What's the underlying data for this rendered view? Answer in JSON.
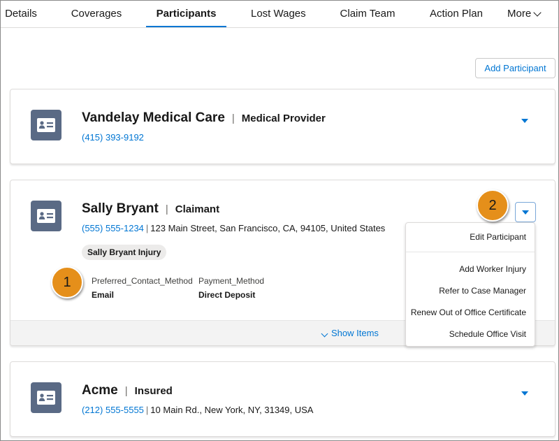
{
  "tabs": [
    {
      "label": "Details"
    },
    {
      "label": "Coverages"
    },
    {
      "label": "Participants",
      "active": true
    },
    {
      "label": "Lost Wages"
    },
    {
      "label": "Claim Team"
    },
    {
      "label": "Action Plan"
    },
    {
      "label": "More"
    }
  ],
  "add_participant_label": "Add Participant",
  "participants": [
    {
      "name": "Vandelay Medical Care",
      "role": "Medical Provider",
      "phone": "(415) 393-9192"
    },
    {
      "name": "Sally Bryant",
      "role": "Claimant",
      "phone": "(555) 555-1234",
      "address": "123 Main Street, San Francisco, CA, 94105, United States",
      "pill": "Sally Bryant Injury",
      "fields": [
        {
          "label": "Preferred_Contact_Method",
          "value": "Email"
        },
        {
          "label": "Payment_Method",
          "value": "Direct Deposit"
        }
      ],
      "footer_link": "Show Items"
    },
    {
      "name": "Acme",
      "role": "Insured",
      "phone": "(212) 555-5555",
      "address": "10 Main Rd., New York, NY, 31349, USA"
    }
  ],
  "menu": {
    "items": [
      "Edit Participant",
      "Add Worker Injury",
      "Refer to Case Manager",
      "Renew Out of Office Certificate",
      "Schedule Office Visit"
    ]
  },
  "callouts": [
    "1",
    "2"
  ],
  "colors": {
    "brand": "#0176d3",
    "avatar": "#5a6a85",
    "callout": "#e58f1a"
  },
  "icons": {
    "avatar": "contact-card-icon",
    "dropdown": "caret-down-icon",
    "more": "chevron-down-icon"
  }
}
